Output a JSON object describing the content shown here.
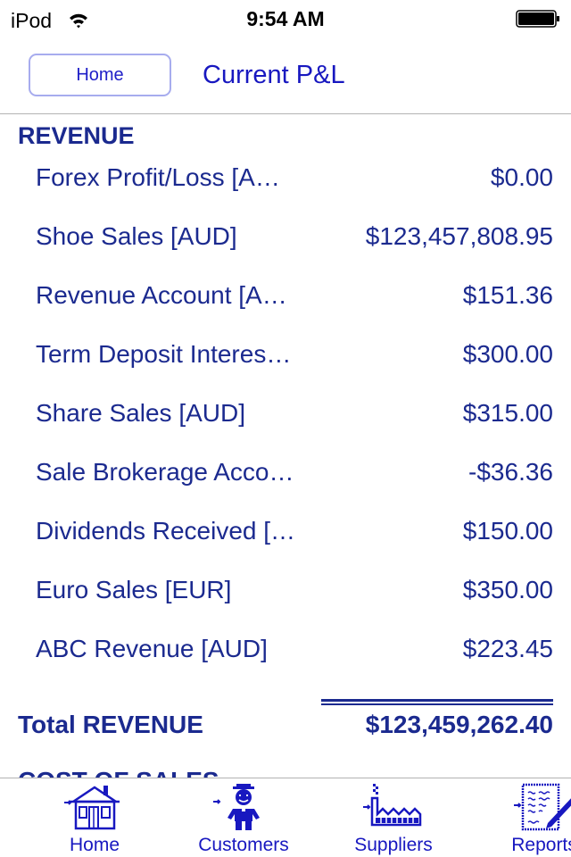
{
  "status_bar": {
    "carrier": "iPod",
    "time": "9:54 AM",
    "wifi_icon": "wifi-icon",
    "battery_icon": "battery-full-icon"
  },
  "nav_bar": {
    "back_button_label": "Home",
    "title": "Current P&L"
  },
  "colors": {
    "text": "#1b2a8f",
    "accent": "#1818c0",
    "button_border": "#a7acee",
    "separator": "#b3b3b3"
  },
  "sections": [
    {
      "title": "REVENUE",
      "rows": [
        {
          "label": "Forex Profit/Loss [A…",
          "value": "$0.00"
        },
        {
          "label": "Shoe Sales [AUD]",
          "value": "$123,457,808.95"
        },
        {
          "label": "Revenue Account [A…",
          "value": "$151.36"
        },
        {
          "label": "Term Deposit Interes…",
          "value": "$300.00"
        },
        {
          "label": "Share Sales [AUD]",
          "value": "$315.00"
        },
        {
          "label": "Sale Brokerage Acco…",
          "value": "-$36.36"
        },
        {
          "label": "Dividends Received […",
          "value": "$150.00"
        },
        {
          "label": "Euro Sales [EUR]",
          "value": "$350.00"
        },
        {
          "label": "ABC Revenue [AUD]",
          "value": "$223.45"
        }
      ],
      "total_label": "Total REVENUE",
      "total_value": "$123,459,262.40"
    },
    {
      "title": "COST OF SALES"
    }
  ],
  "tab_bar": {
    "tabs": [
      {
        "label": "Home",
        "icon": "house-icon"
      },
      {
        "label": "Customers",
        "icon": "customer-icon"
      },
      {
        "label": "Suppliers",
        "icon": "factory-icon"
      },
      {
        "label": "Reports",
        "icon": "report-icon"
      }
    ]
  }
}
